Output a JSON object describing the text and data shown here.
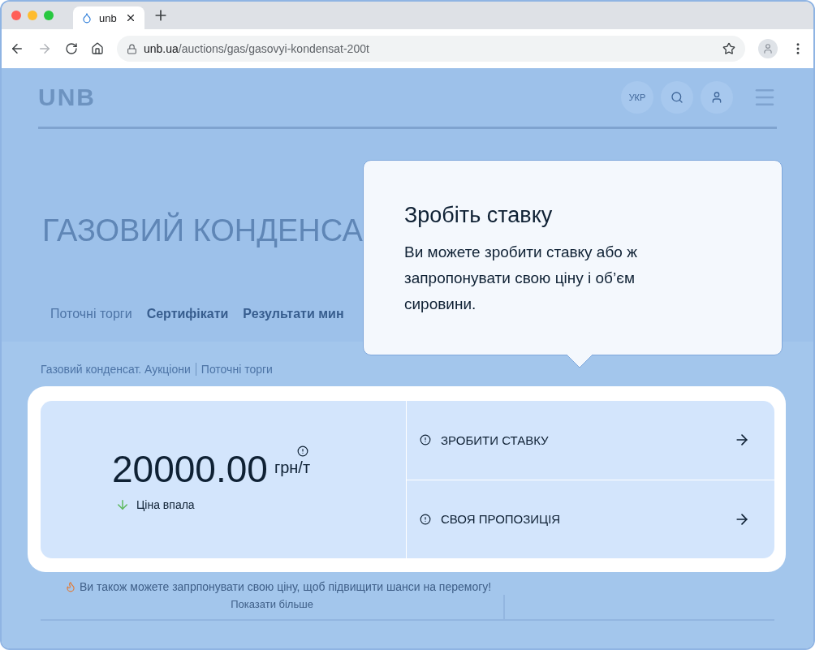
{
  "browser": {
    "tabs": [
      {
        "title": "unb",
        "selected": true
      }
    ],
    "nav": {
      "forward_disabled": true
    },
    "address": {
      "host": "unb.ua",
      "path": "/auctions/gas/gasovyi-kondensat-200t"
    }
  },
  "header": {
    "logo": "UNB",
    "language": "УКР"
  },
  "page_title": "ГАЗОВИЙ КОНДЕНСА",
  "tabs": [
    {
      "label": "Поточні торги",
      "selected": true
    },
    {
      "label": "Сертифікати",
      "selected": false
    },
    {
      "label": "Результати мин",
      "selected": false
    }
  ],
  "breadcrumb": [
    "Газовий конденсат. Аукціони",
    "Поточні торги"
  ],
  "popover": {
    "title": "Зробіть ставку",
    "body": "Ви можете зробити ставку або ж запропонувати свою ціну і об’єм сировини."
  },
  "price": {
    "value": "20000.00",
    "unit": "грн/т",
    "falling": true,
    "trend_label": "Ціна впала"
  },
  "actions": [
    {
      "label": "ЗРОБИТИ СТАВКУ"
    },
    {
      "label": "СВОЯ ПРОПОЗИЦІЯ"
    }
  ],
  "notice": "Ви також можете запрпонувати свою ціну, щоб підвищити шанси на перемогу!",
  "show_more": "Показати більше"
}
